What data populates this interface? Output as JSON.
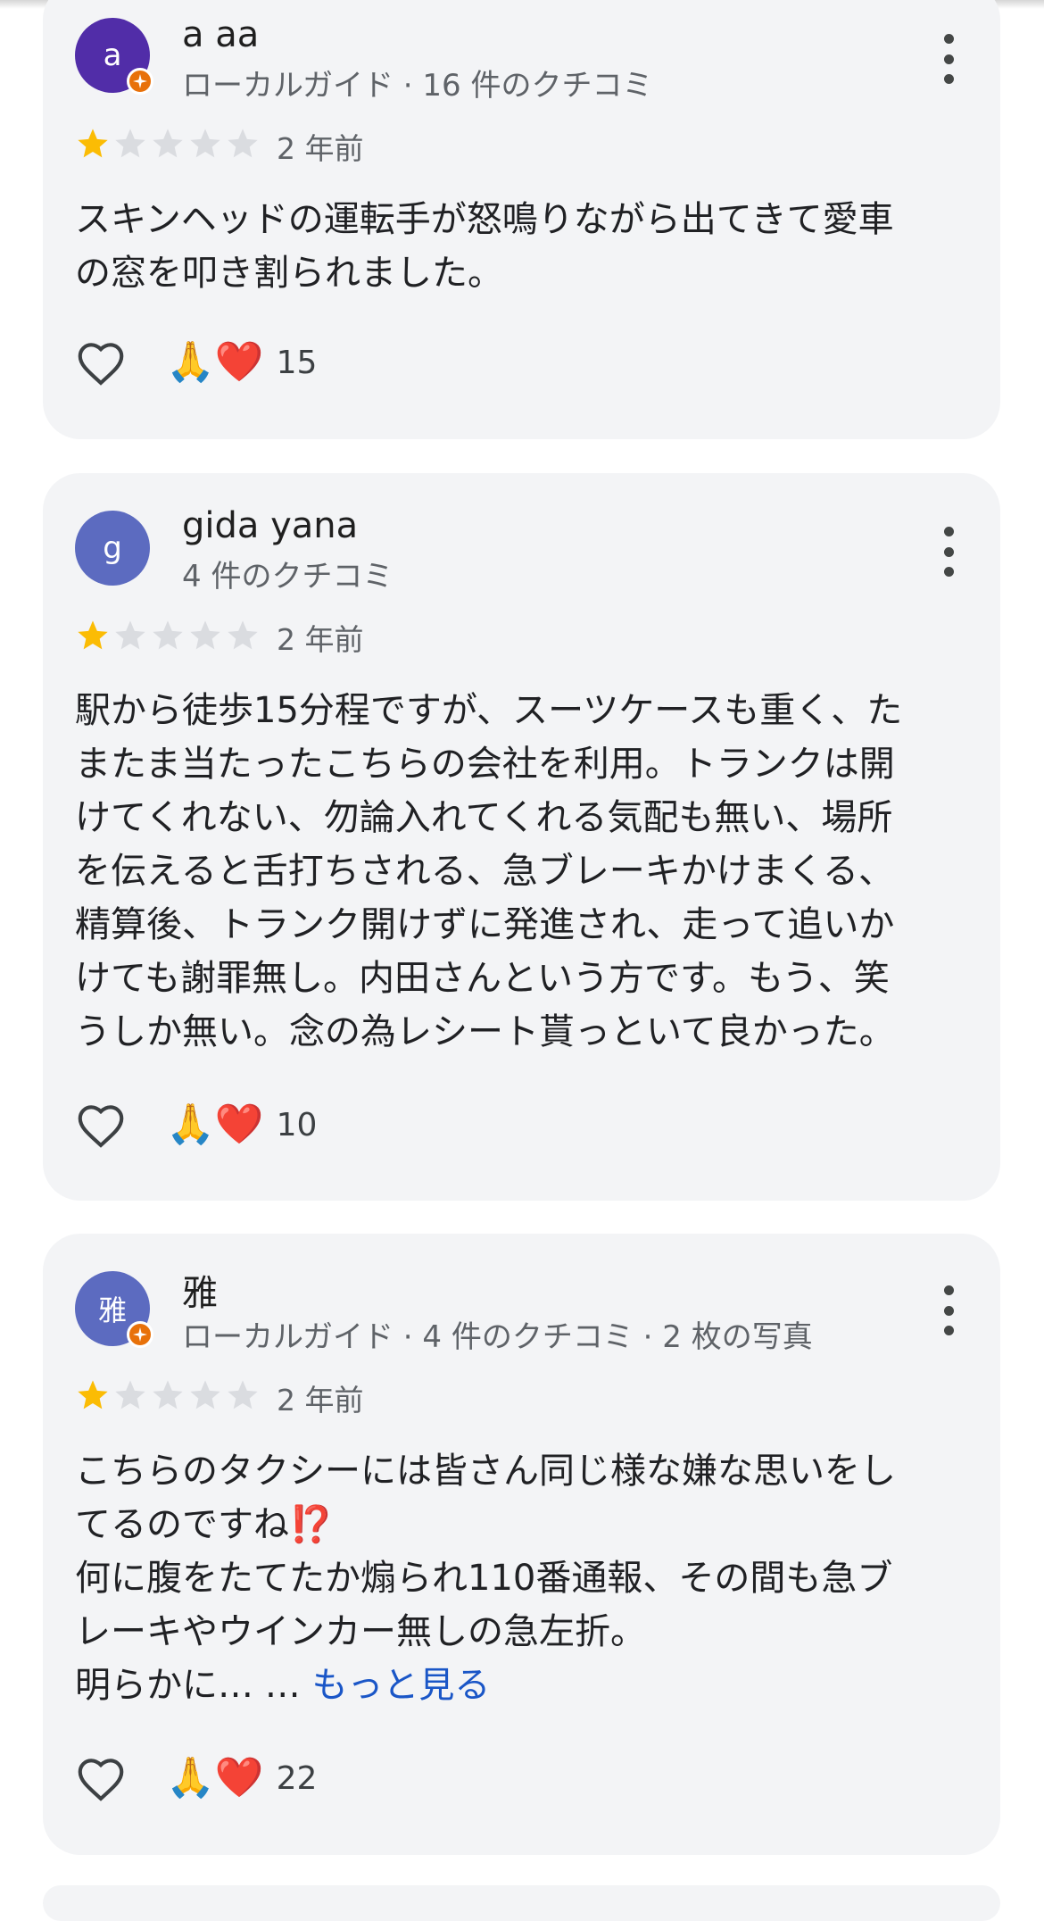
{
  "reviews": [
    {
      "avatar_letter": "a",
      "avatar_color": "#512da8",
      "local_guide": true,
      "name": "a aa",
      "meta": "ローカルガイド · 16 件のクチコミ",
      "rating": 1,
      "time": "2 年前",
      "text": "スキンヘッドの運転手が怒鳴りながら出てきて愛車\nの窓を叩き割られました。",
      "more_label": "",
      "reactions": "🙏❤️",
      "reaction_count": "15"
    },
    {
      "avatar_letter": "g",
      "avatar_color": "#5c6bc0",
      "local_guide": false,
      "name": "gida yana",
      "meta": "4 件のクチコミ",
      "rating": 1,
      "time": "2 年前",
      "text": "駅から徒歩15分程ですが、スーツケースも重く、た\nまたま当たったこちらの会社を利用。トランクは開\nけてくれない、勿論入れてくれる気配も無い、場所\nを伝えると舌打ちされる、急ブレーキかけまくる、\n精算後、トランク開けずに発進され、走って追いか\nけても謝罪無し。内田さんという方です。もう、笑\nうしか無い。念の為レシート貰っといて良かった。",
      "more_label": "",
      "reactions": "🙏❤️",
      "reaction_count": "10"
    },
    {
      "avatar_letter": "雅",
      "avatar_color": "#5c6bc0",
      "local_guide": true,
      "name": "雅",
      "meta": "ローカルガイド · 4 件のクチコミ · 2 枚の写真",
      "rating": 1,
      "time": "2 年前",
      "text": "こちらのタクシーには皆さん同じ様な嫌な思いをし\nてるのですね⁉️\n何に腹をたてたか煽られ110番通報、その間も急ブ\nレーキやウインカー無しの急左折。\n明らかに… … ",
      "more_label": "もっと見る",
      "reactions": "🙏❤️",
      "reaction_count": "22"
    }
  ],
  "colors": {
    "card_bg": "#f3f4f6",
    "star_filled": "#fbbc04",
    "star_empty": "#dadce0",
    "link": "#1a56c7"
  }
}
